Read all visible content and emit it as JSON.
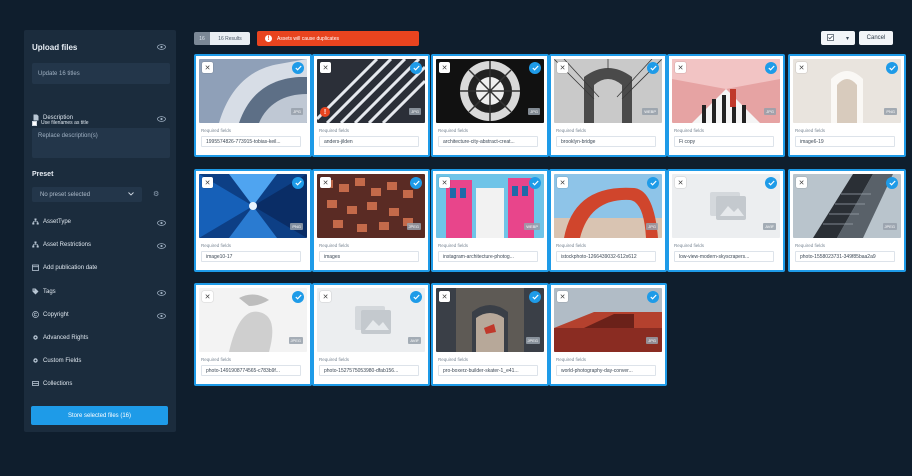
{
  "sidebar": {
    "title": "Upload files",
    "title_input_value": "Update 16 titles",
    "use_filenames_label": "Use filenames as title",
    "description_label": "Description",
    "description_placeholder": "Replace description(s)",
    "preset_title": "Preset",
    "preset_select_value": "No preset selected",
    "rows": [
      {
        "label": "AssetType",
        "icon": "hierarchy-icon"
      },
      {
        "label": "Asset Restrictions",
        "icon": "hierarchy-icon"
      },
      {
        "label": "Add publication date",
        "icon": "calendar-icon"
      },
      {
        "label": "Tags",
        "icon": "tag-icon"
      },
      {
        "label": "Copyright",
        "icon": "copyright-icon"
      },
      {
        "label": "Advanced Rights",
        "icon": "gear-icon"
      },
      {
        "label": "Custom Fields",
        "icon": "gear-icon"
      },
      {
        "label": "Collections",
        "icon": "collection-icon"
      }
    ],
    "store_button": "Store selected files  (16)"
  },
  "toolbar": {
    "count_a": "16",
    "count_b": "16 Results",
    "alert": "Assets will cause duplicates",
    "cancel": "Cancel"
  },
  "cards": [
    {
      "name": "1995574826-773915-tobias-keil...",
      "format": "JPG",
      "required": "Required fields",
      "warning": false
    },
    {
      "name": "anders-jilden",
      "format": "JPG",
      "required": "Required fields",
      "warning": true
    },
    {
      "name": "architecture-city-abstract-creat...",
      "format": "JPG",
      "required": "Required fields",
      "warning": false
    },
    {
      "name": "brooklyn-bridge",
      "format": "WEBP",
      "required": "Required fields",
      "warning": false
    },
    {
      "name": "Fi copy",
      "format": "JPG",
      "required": "Required fields",
      "warning": false
    },
    {
      "name": "image6-19",
      "format": "PNG",
      "required": "Required fields",
      "warning": false
    },
    {
      "name": "image10-17",
      "format": "PNG",
      "required": "Required fields",
      "warning": false
    },
    {
      "name": "images",
      "format": "JPEG",
      "required": "Required fields",
      "warning": false
    },
    {
      "name": "instagram-architecture-photog...",
      "format": "WEBP",
      "required": "Required fields",
      "warning": false
    },
    {
      "name": "istockphoto-1266439032-612x612",
      "format": "JPG",
      "required": "Required fields",
      "warning": false
    },
    {
      "name": "low-view-modern-skyscrapers...",
      "format": "AVIF",
      "required": "Required fields",
      "warning": false
    },
    {
      "name": "photo-1558023731-349f85baa2a9",
      "format": "JPEG",
      "required": "Required fields",
      "warning": false
    },
    {
      "name": "photo-1491908774565-c783b9f...",
      "format": "JPEG",
      "required": "Required fields",
      "warning": false
    },
    {
      "name": "photo-1527575053980-dfab156...",
      "format": "AVIF",
      "required": "Required fields",
      "warning": false
    },
    {
      "name": "pro-boxerz-builder-skater-1_e41...",
      "format": "JPEG",
      "required": "Required fields",
      "warning": false
    },
    {
      "name": "world-photography-day-conver...",
      "format": "JPG",
      "required": "Required fields",
      "warning": false
    }
  ],
  "colors": {
    "accent": "#1e9be8",
    "alert": "#e8441f",
    "background": "#0f1e2d",
    "panel": "#1b2c3d"
  }
}
